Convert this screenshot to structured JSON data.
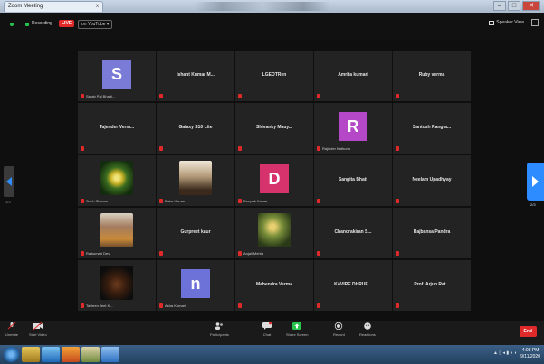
{
  "window": {
    "tab_title": "Zoom Meeting",
    "tab_close": "x",
    "controls": [
      "–",
      "□",
      "✕"
    ]
  },
  "topbar": {
    "rec_status": "Recording",
    "live_label": "LIVE",
    "live_dropdown": "on YouTube ▾",
    "speaker_view_label": "Speaker View",
    "colors": {
      "recording": "#27c24c",
      "live": "#e02929"
    }
  },
  "pager": {
    "left": "1/3",
    "right": "2/3"
  },
  "gallery": {
    "participants": [
      {
        "name": "",
        "caption": "Sarab Pal Bhatti...",
        "kind": "letter",
        "letter": "S",
        "color": "#7a7bd6"
      },
      {
        "name": "Ishant Kumar M...",
        "caption": "",
        "kind": "name"
      },
      {
        "name": "LGEOTRen",
        "caption": "",
        "kind": "name"
      },
      {
        "name": "Amrita kumari",
        "caption": "",
        "kind": "name"
      },
      {
        "name": "Ruby verma",
        "caption": "",
        "kind": "name"
      },
      {
        "name": "Tajender Verm...",
        "caption": "",
        "kind": "name"
      },
      {
        "name": "Galaxy S10 Lite",
        "caption": "",
        "kind": "name"
      },
      {
        "name": "Shivanky Mauy...",
        "caption": "",
        "kind": "name"
      },
      {
        "name": "",
        "caption": "Rajinder Kathuria",
        "kind": "letter",
        "letter": "R",
        "color": "#b448c7"
      },
      {
        "name": "Santosh Rangta...",
        "caption": "",
        "kind": "name"
      },
      {
        "name": "",
        "caption": "Sneh Sharma",
        "kind": "photo",
        "photo": "flower"
      },
      {
        "name": "",
        "caption": "Babu Kumar",
        "kind": "photo",
        "photo": "room"
      },
      {
        "name": "",
        "caption": "Deepak Kumar",
        "kind": "letter",
        "letter": "D",
        "color": "#d6336c"
      },
      {
        "name": "Sangita Bhatt",
        "caption": "",
        "kind": "name"
      },
      {
        "name": "Neelam Upadhyay",
        "caption": "",
        "kind": "name"
      },
      {
        "name": "",
        "caption": "Rajkumari Devi",
        "kind": "photo",
        "photo": "woman"
      },
      {
        "name": "Gurpreet kaur",
        "caption": "",
        "kind": "name"
      },
      {
        "name": "",
        "caption": "Anjali Mehta",
        "kind": "photo",
        "photo": "outdoor"
      },
      {
        "name": "Chandrakiran S...",
        "caption": "",
        "kind": "name"
      },
      {
        "name": "Rajbansa Pandra",
        "caption": "",
        "kind": "name"
      },
      {
        "name": "",
        "caption": "Tavleen Jeet Ki...",
        "kind": "photo",
        "photo": "violin"
      },
      {
        "name": "",
        "caption": "Asha Kumari",
        "kind": "letter",
        "letter": "n",
        "color": "#6d72d8"
      },
      {
        "name": "Mahendra Verma",
        "caption": "",
        "kind": "name"
      },
      {
        "name": "KAVIRE DHRUE...",
        "caption": "",
        "kind": "name"
      },
      {
        "name": "Prof. Arjun Rat...",
        "caption": "",
        "kind": "name"
      }
    ]
  },
  "toolbar": {
    "unmute": "Unmute",
    "start_video": "Start Video",
    "participants": "Participants",
    "chat": "Chat",
    "share_screen": "Share Screen",
    "record": "Record",
    "reactions": "Reactions",
    "end": "End",
    "colors": {
      "share": "#27c24c",
      "end": "#e02929"
    }
  },
  "taskbar": {
    "tray": "▲ ▯ ◂ ▮ ◖ ◗",
    "time": "4:08 PM",
    "date": "9/11/2020"
  }
}
